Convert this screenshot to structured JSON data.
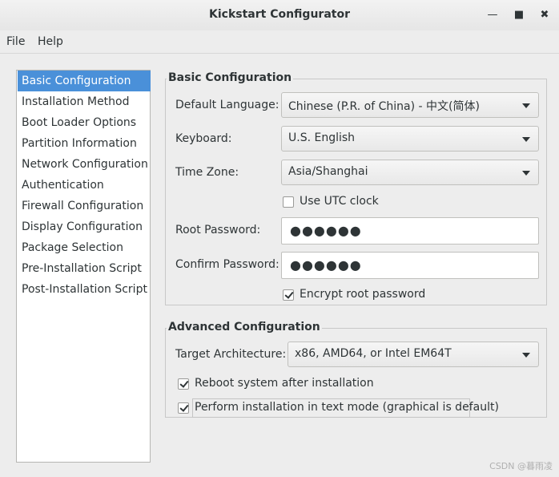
{
  "window": {
    "title": "Kickstart Configurator"
  },
  "menubar": {
    "items": [
      "File",
      "Help"
    ]
  },
  "sidebar": {
    "items": [
      {
        "label": "Basic Configuration",
        "selected": true
      },
      {
        "label": "Installation Method",
        "selected": false
      },
      {
        "label": "Boot Loader Options",
        "selected": false
      },
      {
        "label": "Partition Information",
        "selected": false
      },
      {
        "label": "Network Configuration",
        "selected": false
      },
      {
        "label": "Authentication",
        "selected": false
      },
      {
        "label": "Firewall Configuration",
        "selected": false
      },
      {
        "label": "Display Configuration",
        "selected": false
      },
      {
        "label": "Package Selection",
        "selected": false
      },
      {
        "label": "Pre-Installation Script",
        "selected": false
      },
      {
        "label": "Post-Installation Script",
        "selected": false
      }
    ]
  },
  "basic": {
    "title": "Basic Configuration",
    "default_language_label": "Default Language:",
    "default_language_value": "Chinese (P.R. of China) - 中文(简体)",
    "keyboard_label": "Keyboard:",
    "keyboard_value": "U.S. English",
    "timezone_label": "Time Zone:",
    "timezone_value": "Asia/Shanghai",
    "utc_label": "Use UTC clock",
    "utc_checked": false,
    "root_password_label": "Root Password:",
    "root_password_value": "●●●●●●",
    "confirm_password_label": "Confirm Password:",
    "confirm_password_value": "●●●●●●",
    "encrypt_label": "Encrypt root password",
    "encrypt_checked": true
  },
  "advanced": {
    "title": "Advanced Configuration",
    "arch_label": "Target Architecture:",
    "arch_value": "x86, AMD64, or Intel EM64T",
    "reboot_label": "Reboot system after installation",
    "reboot_checked": true,
    "textmode_label": "Perform installation in text mode (graphical is default)",
    "textmode_checked": true
  },
  "watermark": "CSDN @暮雨凌"
}
